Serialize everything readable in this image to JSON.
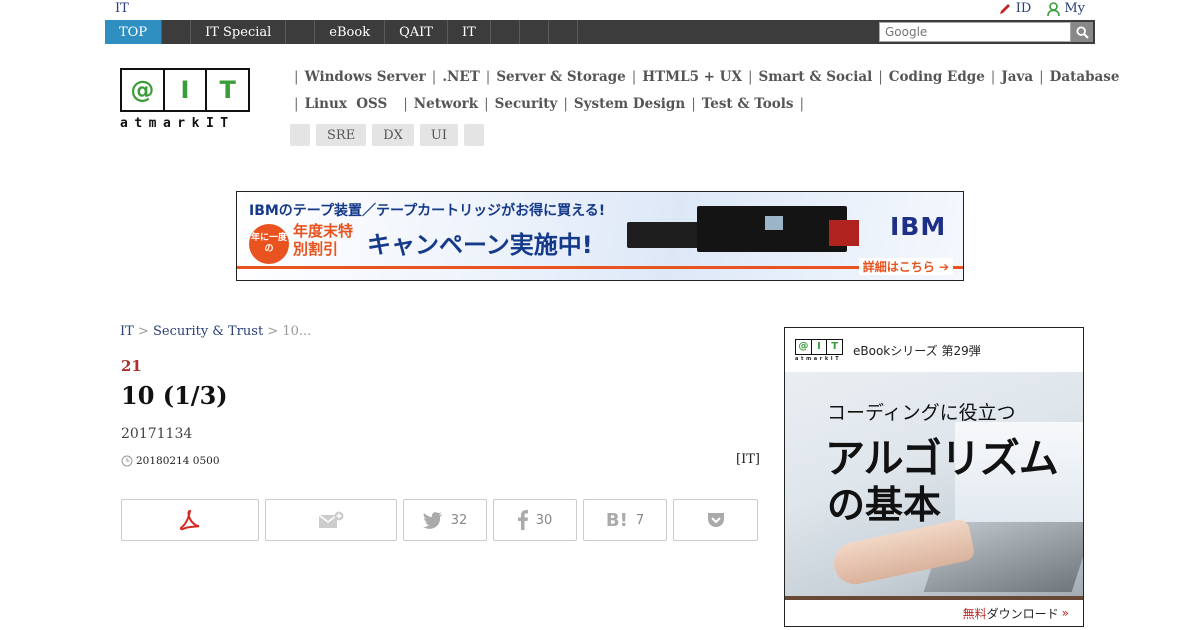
{
  "topstrip": {
    "site_label": "IT",
    "login_label": "ID",
    "mypage_label": "My"
  },
  "nav": {
    "items": [
      {
        "label": "TOP",
        "active": true
      },
      {
        "label": ""
      },
      {
        "label": "IT Special"
      },
      {
        "label": ""
      },
      {
        "label": "eBook"
      },
      {
        "label": "QAIT"
      },
      {
        "label": "IT"
      },
      {
        "label": ""
      },
      {
        "label": ""
      },
      {
        "label": ""
      }
    ],
    "search_placeholder": "Google"
  },
  "logo": {
    "letters": [
      "@",
      "I",
      "T"
    ],
    "tagline": "atmarkIT"
  },
  "categories": {
    "row1": [
      "Windows Server",
      ".NET",
      "Server & Storage",
      "HTML5 + UX",
      "Smart & Social",
      "Coding Edge",
      "Java",
      "Database"
    ],
    "row2": [
      "Linux  OSS",
      "Network",
      "Security",
      "System Design",
      "Test & Tools"
    ],
    "tags": [
      "",
      "SRE",
      "DX",
      "UI",
      ""
    ]
  },
  "banner": {
    "line1": "IBMのテープ装置／テープカートリッジがお得に買える!",
    "badge": "年に一度の",
    "line2": "年度末特別割引",
    "line3": "キャンペーン実施中!",
    "brand": "IBM",
    "cta": "詳細はこちら"
  },
  "breadcrumb": {
    "root": "IT",
    "section": "Security & Trust",
    "current": "10..."
  },
  "article": {
    "eyebrow": "21",
    "title": "10 (1/3)",
    "subtitle": "20171134",
    "date": "20180214 0500",
    "source": "[IT]"
  },
  "share": {
    "twitter_count": "32",
    "facebook_count": "30",
    "hatena_count": "7"
  },
  "sidead": {
    "header": "eBookシリーズ 第29弾",
    "mini_logo": [
      "@",
      "I",
      "T"
    ],
    "mini_tag": "atmarkIT",
    "line1": "コーディングに役立つ",
    "line2": "アルゴリズム",
    "line3": "の基本",
    "foot_red": "無料",
    "foot_rest": "ダウンロード",
    "foot_arrow": "»"
  },
  "colors": {
    "nav_bg": "#3c3c3c",
    "nav_active": "#2e8fc0",
    "logo_green": "#3a9d3a",
    "eyebrow_red": "#b03030",
    "link_blue": "#2a3f7a"
  }
}
